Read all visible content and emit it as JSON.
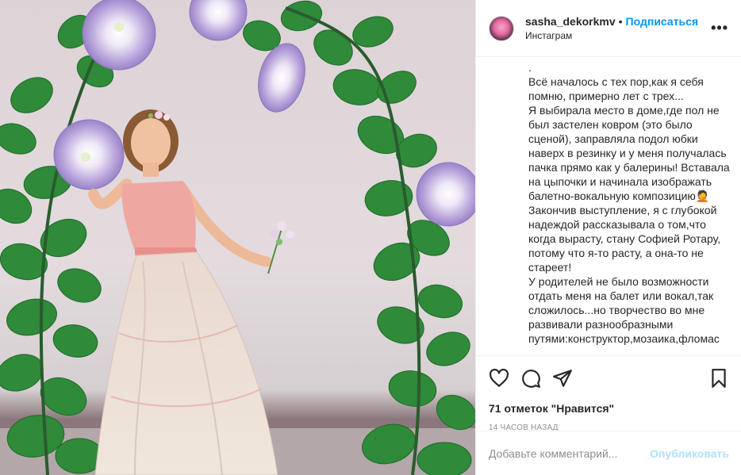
{
  "post": {
    "username": "sasha_dekorkmv",
    "separator": "•",
    "follow_label": "Подписаться",
    "location": "Инстаграм",
    "more_label": "•••"
  },
  "caption": {
    "lines": [
      ".",
      "Всё началось с тех пор,как я себя помню, примерно лет с трех...",
      "Я выбирала место в доме,где пол не был застелен ковром (это было сценой), заправляла подол юбки наверх в резинку и у меня получалась пачка прямо как у балерины! Вставала на цыпочки и начинала изображать балетно-вокальную композицию🤦",
      "Закончив выступление, я с глубокой надеждой рассказывала о том,что когда вырасту, стану Софией Ротару, потому что я-то расту, а она-то не стареет!",
      "У родителей не было возможности отдать меня на балет или вокал,так сложилось...но творчество во мне развивали разнообразными путями:конструктор,мозаика,фломас"
    ]
  },
  "actions": {
    "like_icon": "heart-icon",
    "comment_icon": "comment-icon",
    "share_icon": "paper-plane-icon",
    "save_icon": "bookmark-icon",
    "likes_text": "71 отметок \"Нравится\"",
    "time_text": "14 часов назад"
  },
  "comment": {
    "placeholder": "Добавьте комментарий...",
    "publish_label": "Опубликовать"
  },
  "colors": {
    "accent": "#0095f6",
    "publish_disabled": "#b2dffc",
    "muted": "#8e8e8e",
    "border": "#efefef"
  }
}
